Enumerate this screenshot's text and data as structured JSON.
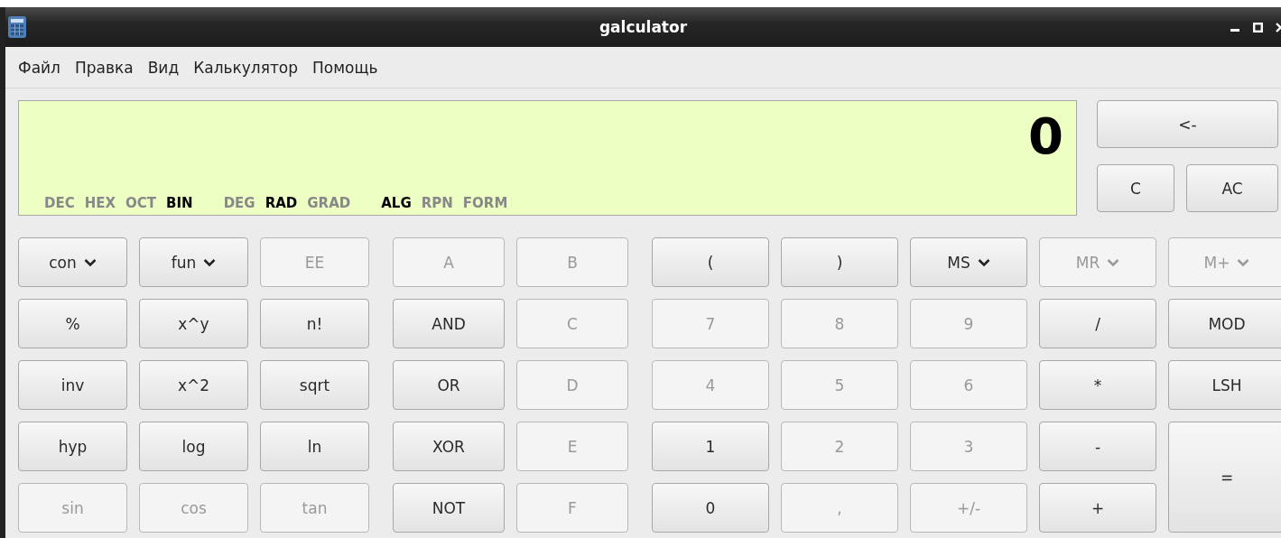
{
  "window": {
    "title": "galculator"
  },
  "menu": [
    "Файл",
    "Правка",
    "Вид",
    "Калькулятор",
    "Помощь"
  ],
  "display": {
    "value": "0",
    "indicator_groups": [
      [
        {
          "label": "DEC",
          "selected": false
        },
        {
          "label": "HEX",
          "selected": false
        },
        {
          "label": "OCT",
          "selected": false
        },
        {
          "label": "BIN",
          "selected": true
        }
      ],
      [
        {
          "label": "DEG",
          "selected": false
        },
        {
          "label": "RAD",
          "selected": true
        },
        {
          "label": "GRAD",
          "selected": false
        }
      ],
      [
        {
          "label": "ALG",
          "selected": true
        },
        {
          "label": "RPN",
          "selected": false
        },
        {
          "label": "FORM",
          "selected": false
        }
      ]
    ]
  },
  "side_buttons": [
    {
      "label": "<-",
      "disabled": false
    },
    {
      "label": "C",
      "disabled": false
    },
    {
      "label": "AC",
      "disabled": false
    }
  ],
  "button_rows": [
    [
      {
        "label": "con",
        "kind": "dropdown",
        "disabled": false
      },
      {
        "label": "fun",
        "kind": "dropdown",
        "disabled": false
      },
      {
        "label": "EE",
        "kind": "plain",
        "disabled": true
      },
      {
        "label": "A",
        "kind": "plain",
        "disabled": true
      },
      {
        "label": "B",
        "kind": "plain",
        "disabled": true
      },
      {
        "label": "(",
        "kind": "plain",
        "disabled": false
      },
      {
        "label": ")",
        "kind": "plain",
        "disabled": false
      },
      {
        "label": "MS",
        "kind": "dropdown",
        "disabled": false
      },
      {
        "label": "MR",
        "kind": "dropdown",
        "disabled": true
      },
      {
        "label": "M+",
        "kind": "dropdown",
        "disabled": true
      }
    ],
    [
      {
        "label": "%",
        "kind": "plain",
        "disabled": false
      },
      {
        "label": "x^y",
        "kind": "plain",
        "disabled": false
      },
      {
        "label": "n!",
        "kind": "plain",
        "disabled": false
      },
      {
        "label": "AND",
        "kind": "plain",
        "disabled": false
      },
      {
        "label": "C",
        "kind": "plain",
        "disabled": true
      },
      {
        "label": "7",
        "kind": "plain",
        "disabled": true
      },
      {
        "label": "8",
        "kind": "plain",
        "disabled": true
      },
      {
        "label": "9",
        "kind": "plain",
        "disabled": true
      },
      {
        "label": "/",
        "kind": "plain",
        "disabled": false
      },
      {
        "label": "MOD",
        "kind": "plain",
        "disabled": false
      }
    ],
    [
      {
        "label": "inv",
        "kind": "plain",
        "disabled": false
      },
      {
        "label": "x^2",
        "kind": "plain",
        "disabled": false
      },
      {
        "label": "sqrt",
        "kind": "plain",
        "disabled": false
      },
      {
        "label": "OR",
        "kind": "plain",
        "disabled": false
      },
      {
        "label": "D",
        "kind": "plain",
        "disabled": true
      },
      {
        "label": "4",
        "kind": "plain",
        "disabled": true
      },
      {
        "label": "5",
        "kind": "plain",
        "disabled": true
      },
      {
        "label": "6",
        "kind": "plain",
        "disabled": true
      },
      {
        "label": "*",
        "kind": "plain",
        "disabled": false
      },
      {
        "label": "LSH",
        "kind": "plain",
        "disabled": false
      }
    ],
    [
      {
        "label": "hyp",
        "kind": "plain",
        "disabled": false
      },
      {
        "label": "log",
        "kind": "plain",
        "disabled": false
      },
      {
        "label": "ln",
        "kind": "plain",
        "disabled": false
      },
      {
        "label": "XOR",
        "kind": "plain",
        "disabled": false
      },
      {
        "label": "E",
        "kind": "plain",
        "disabled": true
      },
      {
        "label": "1",
        "kind": "plain",
        "disabled": false
      },
      {
        "label": "2",
        "kind": "plain",
        "disabled": true
      },
      {
        "label": "3",
        "kind": "plain",
        "disabled": true
      },
      {
        "label": "-",
        "kind": "plain",
        "disabled": false
      },
      {
        "label": "=",
        "kind": "tall",
        "disabled": false
      }
    ],
    [
      {
        "label": "sin",
        "kind": "plain",
        "disabled": true
      },
      {
        "label": "cos",
        "kind": "plain",
        "disabled": true
      },
      {
        "label": "tan",
        "kind": "plain",
        "disabled": true
      },
      {
        "label": "NOT",
        "kind": "plain",
        "disabled": false
      },
      {
        "label": "F",
        "kind": "plain",
        "disabled": true
      },
      {
        "label": "0",
        "kind": "plain",
        "disabled": false
      },
      {
        "label": ",",
        "kind": "plain",
        "disabled": true
      },
      {
        "label": "+/-",
        "kind": "plain",
        "disabled": true
      },
      {
        "label": "+",
        "kind": "plain",
        "disabled": false
      }
    ]
  ]
}
